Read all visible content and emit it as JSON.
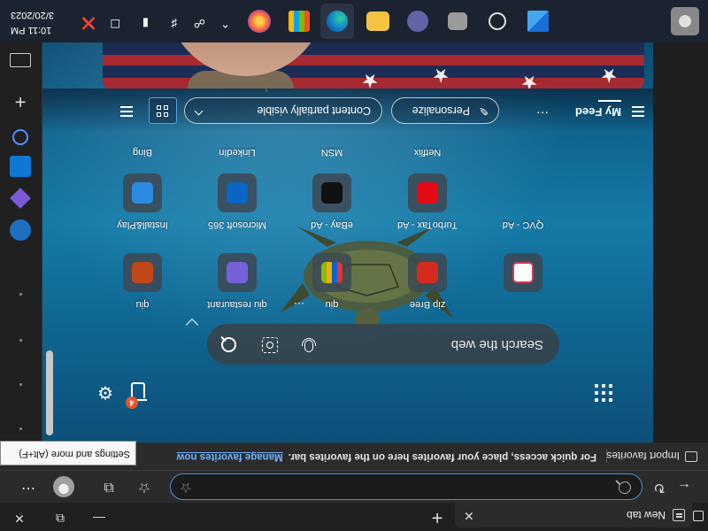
{
  "tab": {
    "title": "New tab",
    "close": "✕",
    "new_tab": "+"
  },
  "window_controls": {
    "minimize": "—",
    "restore": "⧉",
    "close": "✕"
  },
  "toolbar": {
    "back": "→",
    "refresh": "↻",
    "address_value": "",
    "favorites_icon": "star-plus-icon",
    "more": "⋯"
  },
  "favorites_bar": {
    "import": "Import favorites",
    "message": "For quick access, place your favorites here on the favorites bar.",
    "manage_link": "Manage favorites now"
  },
  "tooltip": "Settings and more (Alt+F)",
  "search": {
    "placeholder": "Search the web"
  },
  "quick_links": [
    {
      "label": "Bing",
      "color": "#2a8be0",
      "glyph": "b"
    },
    {
      "label": "LinkedIn",
      "color": "#0a66c2",
      "glyph": "in"
    },
    {
      "label": "MSN",
      "color": "#111111",
      "glyph": "✈"
    },
    {
      "label": "Netflix",
      "color": "#e50914",
      "glyph": "N"
    },
    {
      "label": "Install&Play",
      "color": "#c1461a",
      "glyph": "✦"
    },
    {
      "label": "Microsoft 365",
      "color": "#7561d8",
      "glyph": "◆"
    },
    {
      "label": "eBay - Ad",
      "color": "#333333",
      "glyph": "▦"
    },
    {
      "label": "TurboTax - Ad",
      "color": "#d52b1e",
      "glyph": "✓"
    },
    {
      "label": "QVC - Ad",
      "color": "#ffffff",
      "glyph": "◯"
    }
  ],
  "sub_labels": [
    "qiu",
    "qiu restaurant",
    "qiu",
    "zip Bree"
  ],
  "bin_badge": "4",
  "feed": {
    "title": "My Feed",
    "more": "⋯",
    "personalize": "Personalize",
    "content_visibility": "Content partially visible"
  },
  "taskbar": {
    "time": "10:11 PM",
    "date": "3/20/2023",
    "apps": [
      "start-icon",
      "search-icon",
      "task-view-icon",
      "teams-icon",
      "file-explorer-icon",
      "edge-icon",
      "store-icon",
      "firefox-icon"
    ],
    "tray": [
      "chevron-up-icon",
      "network-icon",
      "volume-icon",
      "battery-icon"
    ]
  },
  "colors": {
    "accent": "#4a8ed6",
    "link": "#6fb3ff",
    "page_top": "#0c4f78",
    "page_mid": "#157aa7"
  }
}
